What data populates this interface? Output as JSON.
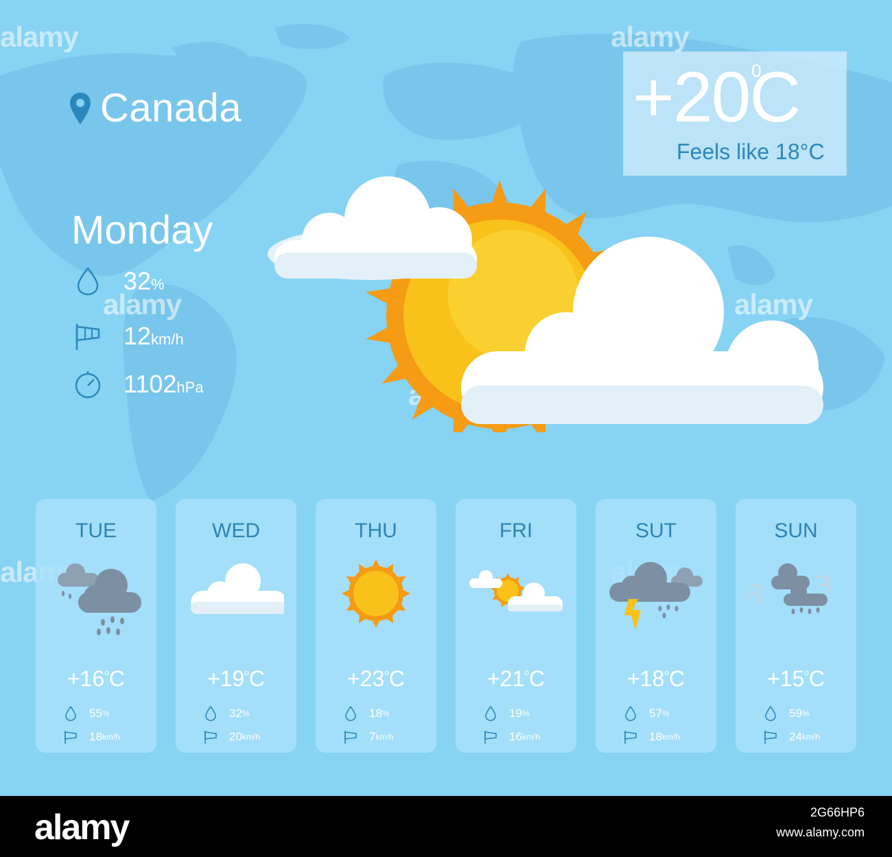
{
  "location": {
    "name": "Canada",
    "icon": "location-pin-icon"
  },
  "current": {
    "temp": "+20",
    "deg": "0",
    "unit": "C",
    "feels_like": "Feels like 18°C"
  },
  "today": {
    "day": "Monday",
    "humidity": {
      "value": "32",
      "unit": "%",
      "icon": "droplet-icon"
    },
    "wind": {
      "value": "12",
      "unit": "km/h",
      "icon": "windsock-icon"
    },
    "pressure": {
      "value": "1102",
      "unit": "hPa",
      "icon": "gauge-icon"
    }
  },
  "forecast": [
    {
      "day": "TUE",
      "temp": "+16",
      "unit": "C",
      "humidity": "55",
      "hum_unit": "%",
      "wind": "18",
      "wind_unit": "km/h",
      "icon": "rain-clouds-icon"
    },
    {
      "day": "WED",
      "temp": "+19",
      "unit": "C",
      "humidity": "32",
      "hum_unit": "%",
      "wind": "20",
      "wind_unit": "km/h",
      "icon": "cloud-icon"
    },
    {
      "day": "THU",
      "temp": "+23",
      "unit": "C",
      "humidity": "18",
      "hum_unit": "%",
      "wind": "7",
      "wind_unit": "km/h",
      "icon": "sun-icon"
    },
    {
      "day": "FRI",
      "temp": "+21",
      "unit": "C",
      "humidity": "19",
      "hum_unit": "%",
      "wind": "16",
      "wind_unit": "km/h",
      "icon": "partly-cloudy-icon"
    },
    {
      "day": "SUT",
      "temp": "+18",
      "unit": "C",
      "humidity": "57",
      "hum_unit": "%",
      "wind": "18",
      "wind_unit": "km/h",
      "icon": "thunderstorm-icon"
    },
    {
      "day": "SUN",
      "temp": "+15",
      "unit": "C",
      "humidity": "59",
      "hum_unit": "%",
      "wind": "24",
      "wind_unit": "km/h",
      "icon": "windy-rain-icon"
    }
  ],
  "watermark": {
    "brand": "alamy",
    "image_id": "2G66HP6",
    "site": "www.alamy.com"
  },
  "colors": {
    "background": "#87d3f4",
    "accent_text": "#2b88bc",
    "sun": "#f9c21a",
    "sun_rays": "#f59b14",
    "cloud": "#ffffff",
    "storm_cloud": "#7d8fa2"
  }
}
